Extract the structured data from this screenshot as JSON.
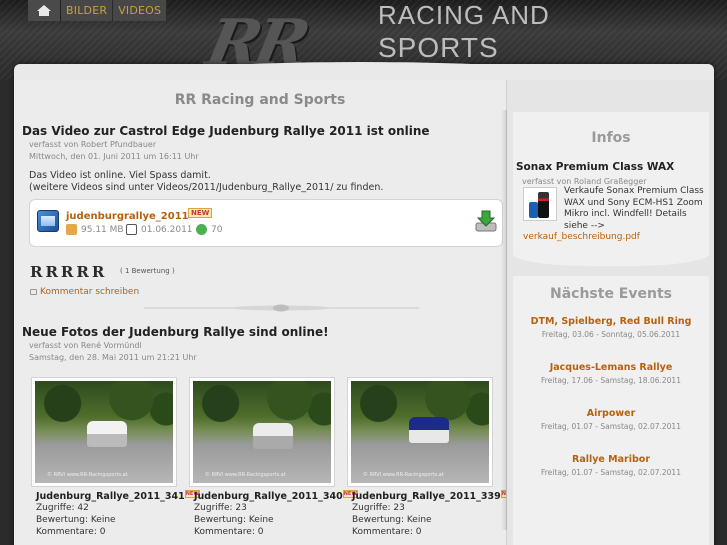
{
  "nav": {
    "items": [
      "BILDER",
      "VIDEOS"
    ]
  },
  "logo": {
    "mark": "RR",
    "line1": "RACING AND",
    "line2": "SPORTS"
  },
  "main": {
    "site_title": "RR Racing and Sports",
    "post1": {
      "title": "Das Video zur Castrol Edge Judenburg Rallye 2011 ist online",
      "author": "verfasst von Robert Pfundbauer",
      "date": "Mittwoch, den 01. Juni 2011 um 16:11 Uhr",
      "body_line1": "Das Video ist online. Viel Spass damit.",
      "body_line2": "(weitere Videos sind unter Videos/2011/Judenburg_Rallye_2011/ zu finden.",
      "download": {
        "filename": "judenburgrallye_2011",
        "badge": "NEW",
        "size": "95.11 MB",
        "date": "01.06.2011",
        "downloads": "70"
      },
      "rating_stars": "RRRRR",
      "rating_count": "( 1 Bewertung )",
      "comment_link": "Kommentar schreiben"
    },
    "post2": {
      "title": "Neue Fotos der Judenburg Rallye sind online!",
      "author": "verfasst von René Vormündl",
      "date": "Samstag, den 28. Mai 2011 um 21:21 Uhr",
      "photos": [
        {
          "name": "Judenburg_Rallye_2011_341",
          "hits": "Zugriffe: 42",
          "rating": "Bewertung: Keine",
          "comments": "Kommentare: 0"
        },
        {
          "name": "Judenburg_Rallye_2011_340",
          "hits": "Zugriffe: 23",
          "rating": "Bewertung: Keine",
          "comments": "Kommentare: 0"
        },
        {
          "name": "Judenburg_Rallye_2011_339",
          "hits": "Zugriffe: 23",
          "rating": "Bewertung: Keine",
          "comments": "Kommentare: 0"
        }
      ],
      "photo_badge": "NEW",
      "watermark": "© RRVI www.RR-Racingsports.at"
    }
  },
  "sidebar": {
    "infos_heading": "Infos",
    "sonax": {
      "title": "Sonax Premium Class WAX",
      "author": "verfasst von Roland Graßegger",
      "description": "Verkaufe Sonax Premium Class WAX und Sony ECM-HS1 Zoom Mikro incl. Windfell! Details siehe -->",
      "link": "verkauf_beschreibung.pdf"
    },
    "events_heading": "Nächste Events",
    "events": [
      {
        "name": "DTM, Spielberg, Red Bull Ring",
        "date": "Freitag, 03.06 - Sonntag, 05.06.2011"
      },
      {
        "name": "Jacques-Lemans Rallye",
        "date": "Freitag, 17.06 - Samstag, 18.06.2011"
      },
      {
        "name": "Airpower",
        "date": "Freitag, 01.07 - Samstag, 02.07.2011"
      },
      {
        "name": "Rallye Maribor",
        "date": "Freitag, 01.07 - Samstag, 02.07.2011"
      }
    ]
  },
  "colors": {
    "link": "#b8610c",
    "nav_text": "#c9a03c",
    "heading_gray": "#8a8a8a"
  }
}
